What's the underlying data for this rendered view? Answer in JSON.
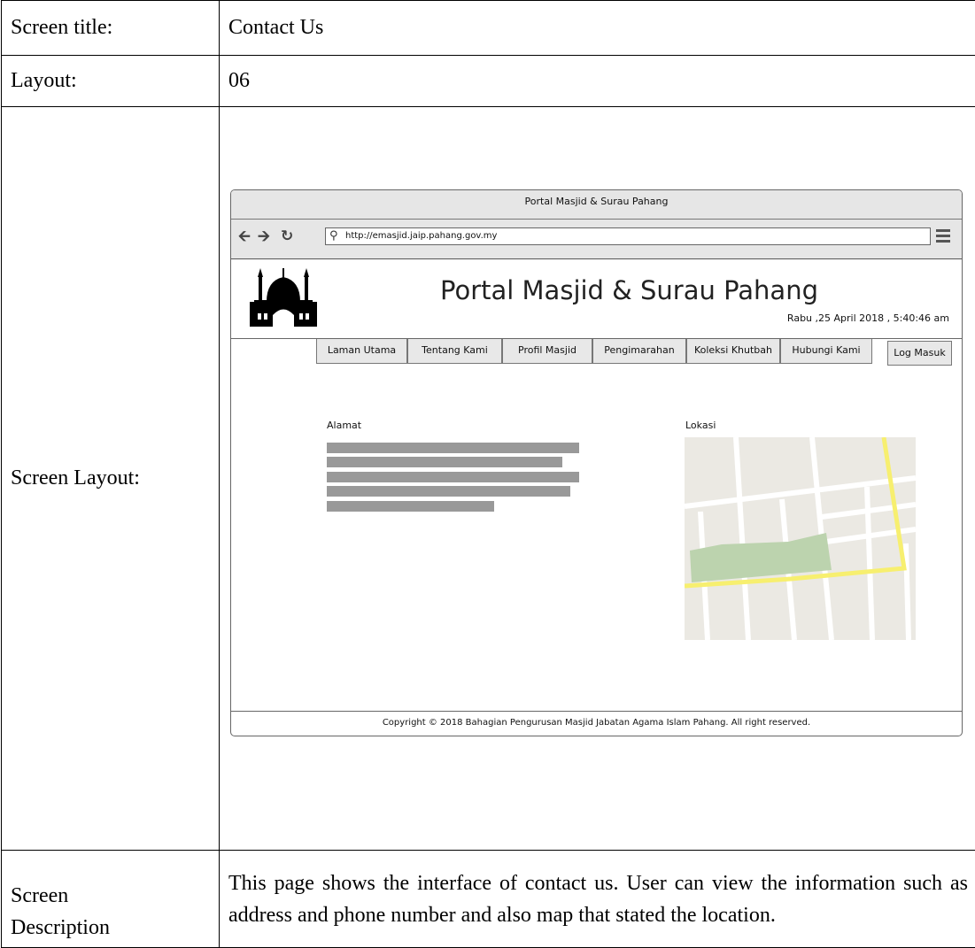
{
  "document": {
    "rows": [
      {
        "label": "Screen title:",
        "value": "Contact Us"
      },
      {
        "label": "Layout:",
        "value": "06"
      },
      {
        "label": "Screen Layout:"
      }
    ],
    "description": {
      "label_line1": "Screen",
      "label_line2": "Description",
      "text": "This page shows the interface of contact us. User can view the information such as address and phone number and also map that stated the location."
    }
  },
  "browser": {
    "window_title": "Portal Masjid & Surau Pahang",
    "back_icon": "arrow-left-icon",
    "forward_icon": "arrow-right-icon",
    "reload_icon": "reload-icon",
    "url": "http://emasjid.jaip.pahang.gov.my",
    "menu_icon": "hamburger-menu-icon"
  },
  "site": {
    "logo_icon": "mosque-icon",
    "title": "Portal Masjid & Surau Pahang",
    "datetime": "Rabu ,25 April 2018 , 5:40:46 am",
    "nav": [
      "Laman Utama",
      "Tentang Kami",
      "Profil Masjid",
      "Pengimarahan",
      "Koleksi Khutbah",
      "Hubungi Kami"
    ],
    "login_label": "Log Masuk",
    "address_label": "Alamat",
    "address_placeholder_lines": 5,
    "location_label": "Lokasi",
    "map_colors": {
      "land": "#ebe9e3",
      "road": "#ffffff",
      "main_road": "#f7ef6f",
      "park": "#bcd3ae"
    },
    "footer": "Copyright © 2018 Bahagian Pengurusan Masjid Jabatan Agama Islam Pahang. All right reserved."
  }
}
